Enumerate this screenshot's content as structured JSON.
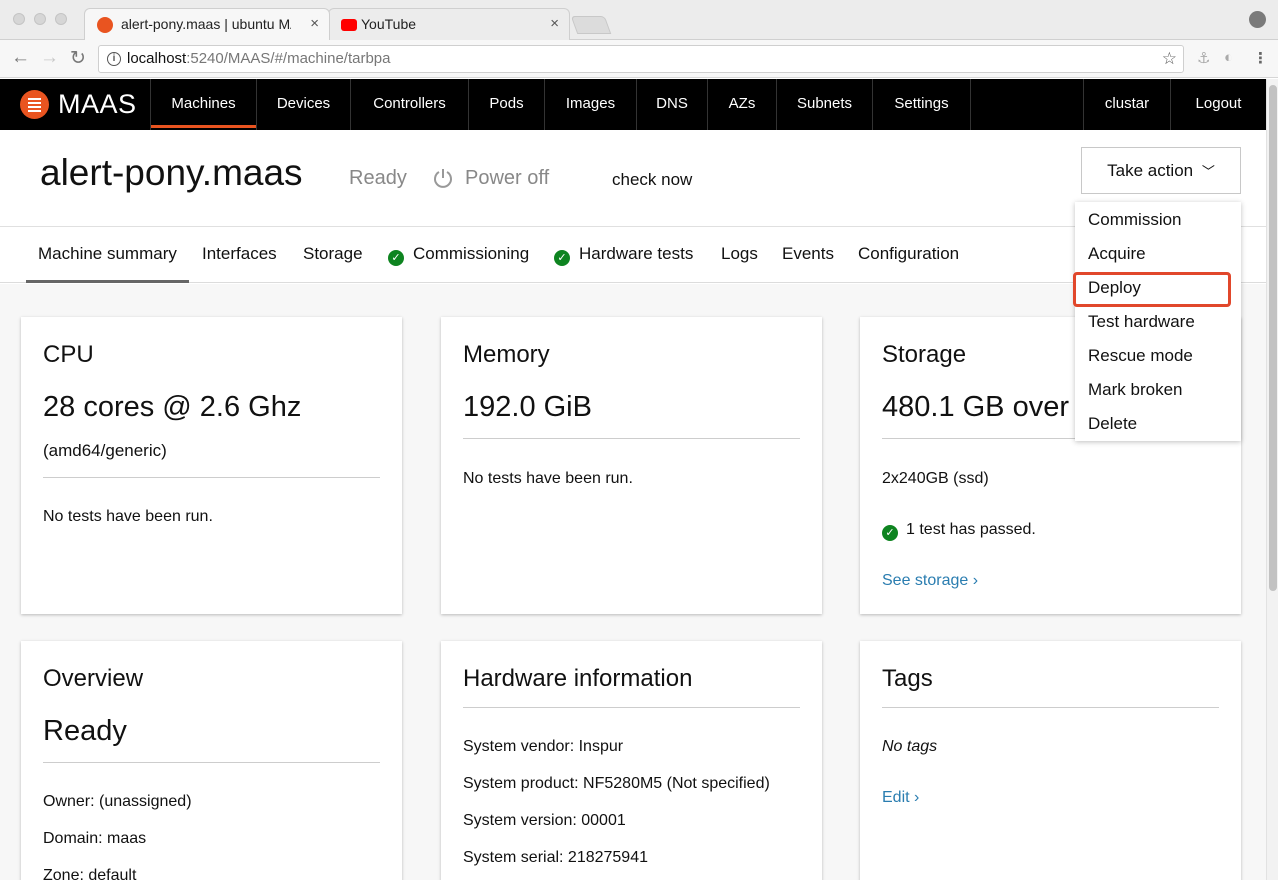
{
  "browser": {
    "tabs": [
      {
        "title": "alert-pony.maas | ubuntu MAA",
        "favicon_color": "#e95420"
      },
      {
        "title": "YouTube",
        "favicon_color": "#ff0000"
      }
    ],
    "close_glyph": "×",
    "url_host": "localhost",
    "url_path": ":5240/MAAS/#/machine/tarbpa"
  },
  "nav": {
    "brand": "MAAS",
    "items": [
      "Machines",
      "Devices",
      "Controllers",
      "Pods",
      "Images",
      "DNS",
      "AZs",
      "Subnets",
      "Settings"
    ],
    "active": "Machines",
    "user": "clustar",
    "logout": "Logout"
  },
  "header": {
    "hostname": "alert-pony.maas",
    "status": "Ready",
    "power": "Power off",
    "check_now": "check now",
    "take_action": "Take action"
  },
  "subtabs": [
    {
      "label": "Machine summary",
      "active": true
    },
    {
      "label": "Interfaces"
    },
    {
      "label": "Storage"
    },
    {
      "label": "Commissioning",
      "check": true
    },
    {
      "label": "Hardware tests",
      "check": true
    },
    {
      "label": "Logs"
    },
    {
      "label": "Events"
    },
    {
      "label": "Configuration"
    }
  ],
  "cards": {
    "cpu": {
      "title": "CPU",
      "value": "28 cores @ 2.6 Ghz",
      "arch": "(amd64/generic)",
      "tests": "No tests have been run."
    },
    "memory": {
      "title": "Memory",
      "value": "192.0 GiB",
      "tests": "No tests have been run."
    },
    "storage": {
      "title": "Storage",
      "value": "480.1 GB over",
      "disks": "2x240GB (ssd)",
      "tests": "1 test has passed.",
      "link": "See storage ›"
    },
    "overview": {
      "title": "Overview",
      "status": "Ready",
      "owner": "Owner: (unassigned)",
      "domain": "Domain: maas",
      "zone": "Zone: default"
    },
    "hardware": {
      "title": "Hardware information",
      "vendor": "System vendor: Inspur",
      "product": "System product: NF5280M5 (Not specified)",
      "version": "System version: 00001",
      "serial": "System serial: 218275941"
    },
    "tags": {
      "title": "Tags",
      "empty": "No tags",
      "edit": "Edit ›"
    }
  },
  "action_menu": [
    "Commission",
    "Acquire",
    "Deploy",
    "Test hardware",
    "Rescue mode",
    "Mark broken",
    "Delete"
  ],
  "highlighted_action": "Deploy",
  "colors": {
    "accent": "#e95420",
    "success": "#0e8420",
    "link": "#2a7db0",
    "highlight": "#e1472b"
  }
}
